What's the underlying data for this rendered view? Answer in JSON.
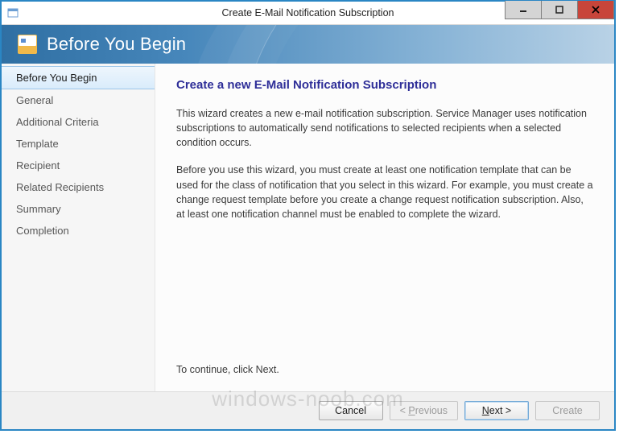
{
  "window": {
    "title": "Create E-Mail Notification Subscription"
  },
  "banner": {
    "heading": "Before You Begin"
  },
  "sidebar": {
    "items": [
      {
        "label": "Before You Begin",
        "active": true
      },
      {
        "label": "General"
      },
      {
        "label": "Additional Criteria"
      },
      {
        "label": "Template"
      },
      {
        "label": "Recipient"
      },
      {
        "label": "Related Recipients"
      },
      {
        "label": "Summary"
      },
      {
        "label": "Completion"
      }
    ]
  },
  "content": {
    "heading": "Create a new E-Mail Notification Subscription",
    "para1": "This wizard creates a new e-mail notification subscription. Service Manager uses notification subscriptions to automatically send notifications to selected recipients when a selected condition occurs.",
    "para2": "Before you use this wizard, you must create at least one notification template that can be used for the class of notification that you select in this wizard. For example, you must create a change request template before you create a change request notification subscription. Also, at least one notification channel must be enabled to complete the wizard.",
    "continue": "To continue, click Next."
  },
  "buttons": {
    "cancel": "Cancel",
    "previous_prefix": "< ",
    "previous_accel": "P",
    "previous_suffix": "revious",
    "next_accel": "N",
    "next_suffix": "ext >",
    "create": "Create"
  },
  "watermark": "windows-noob.com"
}
